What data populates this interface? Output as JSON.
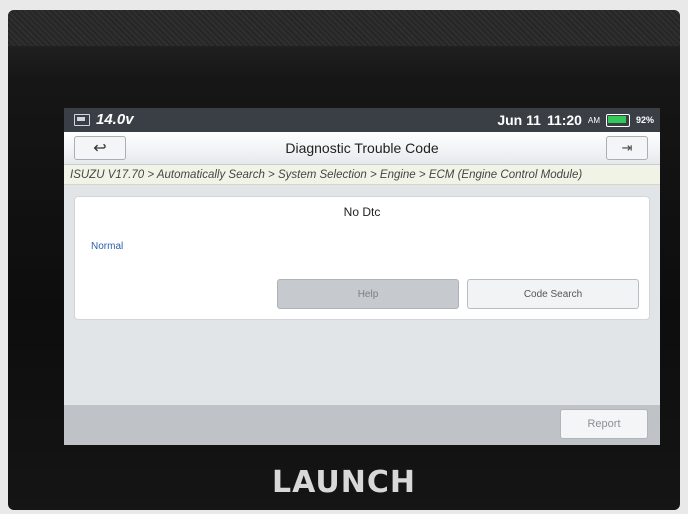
{
  "status_bar": {
    "voltage": "14.0v",
    "date": "Jun 11",
    "time": "11:20",
    "ampm": "AM",
    "battery": "92%"
  },
  "header": {
    "title": "Diagnostic Trouble Code",
    "back_icon": "back-arrow-icon",
    "exit_icon": "exit-icon"
  },
  "breadcrumb": "ISUZU V17.70 > Automatically Search > System Selection > Engine > ECM (Engine Control Module)",
  "dtc": {
    "title": "No Dtc",
    "status": "Normal",
    "help_label": "Help",
    "code_search_label": "Code Search"
  },
  "footer": {
    "report_label": "Report"
  },
  "device": {
    "brand": "LAUNCH"
  },
  "colors": {
    "status_bar_bg": "#3a3f46",
    "status_text_blue": "#2f5fa8",
    "battery_green": "#34c759"
  }
}
